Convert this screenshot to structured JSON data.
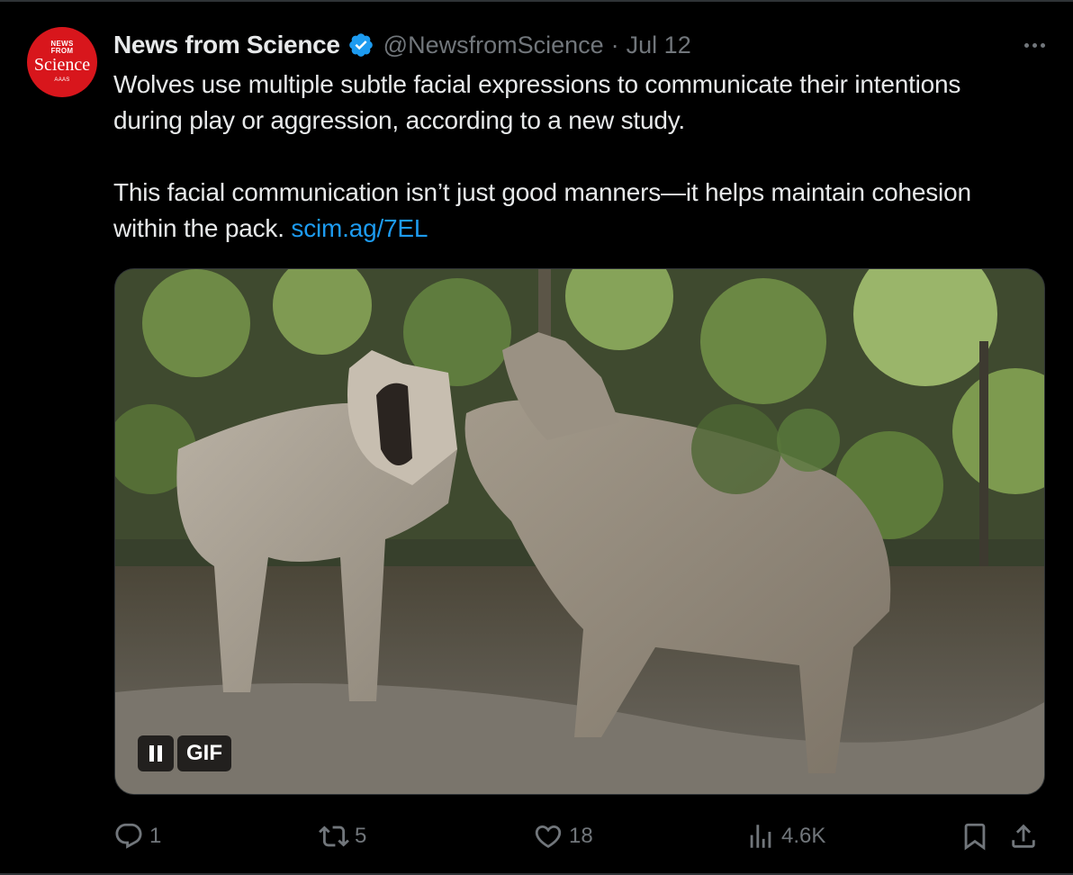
{
  "tweet": {
    "avatar": {
      "line1": "NEWS",
      "line1b": "FROM",
      "line2": "Science",
      "line3": "AAAS"
    },
    "author_name": "News from Science",
    "handle": "@NewsfromScience",
    "separator": "·",
    "date": "Jul 12",
    "paragraph1": "Wolves use multiple subtle facial expressions to communicate their intentions during play or aggression, according to a new study.",
    "paragraph2": "This facial communication isn’t just good manners—it helps maintain cohesion within the pack.",
    "link_text": "scim.ag/7EL",
    "media": {
      "type": "gif",
      "badge": "GIF",
      "alt_icon": "pause-icon"
    },
    "actions": {
      "replies": "1",
      "reposts": "5",
      "likes": "18",
      "views": "4.6K"
    }
  },
  "colors": {
    "background": "#000000",
    "text": "#e7e9ea",
    "muted": "#71767b",
    "link": "#1d9bf0",
    "verified": "#1d9bf0",
    "avatar_bg": "#d8161c"
  }
}
